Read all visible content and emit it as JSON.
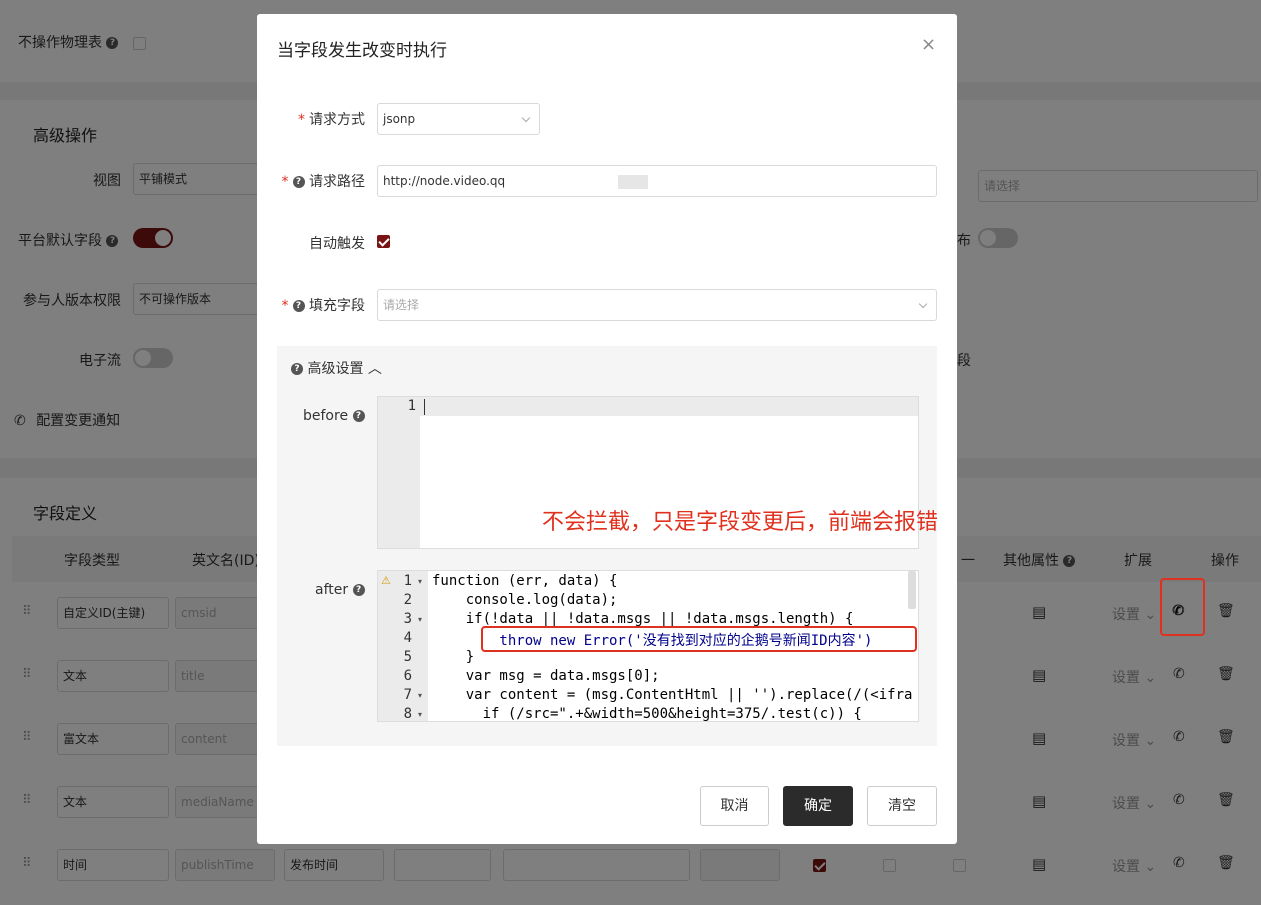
{
  "background": {
    "top_field": {
      "label": "不操作物理表"
    },
    "advanced_section": {
      "title": "高级操作"
    },
    "view_label": "视图",
    "view_value": "平铺模式",
    "platform_default_label": "平台默认字段",
    "participant_label": "参与人版本权限",
    "participant_value": "不可操作版本",
    "e_flow_label": "电子流",
    "config_notify_label": "配置变更通知",
    "right_select_placeholder": "请选择",
    "right_label_partial": "布",
    "right_label_partial2": "段",
    "field_def_title": "字段定义",
    "table_headers": [
      "字段类型",
      "英文名(ID)",
      "一",
      "其他属性",
      "扩展",
      "操作"
    ],
    "rows": [
      {
        "type": "自定义ID(主键)",
        "id": "cmsid",
        "settings": "设置"
      },
      {
        "type": "文本",
        "id": "title",
        "settings": "设置"
      },
      {
        "type": "富文本",
        "id": "content",
        "settings": "设置"
      },
      {
        "type": "文本",
        "id": "mediaName",
        "settings": "设置"
      },
      {
        "type": "时间",
        "id": "publishTime",
        "cn_name": "发布时间",
        "settings": "设置"
      }
    ]
  },
  "modal": {
    "title": "当字段发生改变时执行",
    "request_method_label": "请求方式",
    "request_method_value": "jsonp",
    "request_path_label": "请求路径",
    "request_path_value": "http://node.video.qq",
    "auto_trigger_label": "自动触发",
    "fill_field_label": "填充字段",
    "fill_field_placeholder": "请选择",
    "advanced_label": "高级设置",
    "before_label": "before",
    "after_label": "after",
    "before_lines": [
      "1"
    ],
    "after_line_numbers": [
      "1",
      "2",
      "3",
      "4",
      "5",
      "6",
      "7",
      "8"
    ],
    "annotation": "不会拦截，只是字段变更后，前端会报错",
    "buttons": {
      "cancel": "取消",
      "confirm": "确定",
      "clear": "清空"
    }
  },
  "code": {
    "l1": "function (err, data) {",
    "l2": "    console.log(data);",
    "l3": "    if(!data || !data.msgs || !data.msgs.length) {",
    "l4": "        throw new Error('没有找到对应的企鹅号新闻ID内容')",
    "l5": "    }",
    "l6": "    var msg = data.msgs[0];",
    "l7": "    var content = (msg.ContentHtml || '').replace(/(<ifra",
    "l8": "      if (/src=\".+&width=500&height=375/.test(c)) {"
  },
  "colors": {
    "accent": "#7a1414",
    "annotation": "#e0301e",
    "primary_button": "#2b2b2b"
  }
}
